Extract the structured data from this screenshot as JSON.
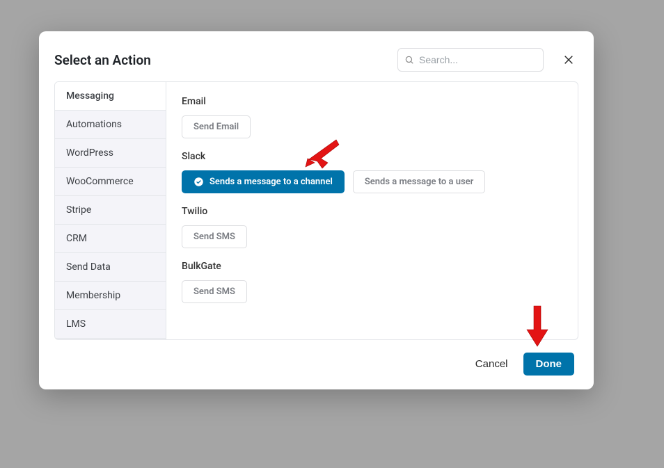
{
  "modal": {
    "title": "Select an Action",
    "search_placeholder": "Search...",
    "cancel_label": "Cancel",
    "done_label": "Done"
  },
  "sidebar": {
    "items": [
      {
        "label": "Messaging",
        "active": true
      },
      {
        "label": "Automations",
        "active": false
      },
      {
        "label": "WordPress",
        "active": false
      },
      {
        "label": "WooCommerce",
        "active": false
      },
      {
        "label": "Stripe",
        "active": false
      },
      {
        "label": "CRM",
        "active": false
      },
      {
        "label": "Send Data",
        "active": false
      },
      {
        "label": "Membership",
        "active": false
      },
      {
        "label": "LMS",
        "active": false
      }
    ]
  },
  "groups": [
    {
      "name": "Email",
      "actions": [
        {
          "label": "Send Email",
          "selected": false
        }
      ]
    },
    {
      "name": "Slack",
      "actions": [
        {
          "label": "Sends a message to a channel",
          "selected": true
        },
        {
          "label": "Sends a message to a user",
          "selected": false
        }
      ]
    },
    {
      "name": "Twilio",
      "actions": [
        {
          "label": "Send SMS",
          "selected": false
        }
      ]
    },
    {
      "name": "BulkGate",
      "actions": [
        {
          "label": "Send SMS",
          "selected": false
        }
      ]
    }
  ],
  "colors": {
    "accent": "#0073aa",
    "arrow": "#e31414"
  }
}
